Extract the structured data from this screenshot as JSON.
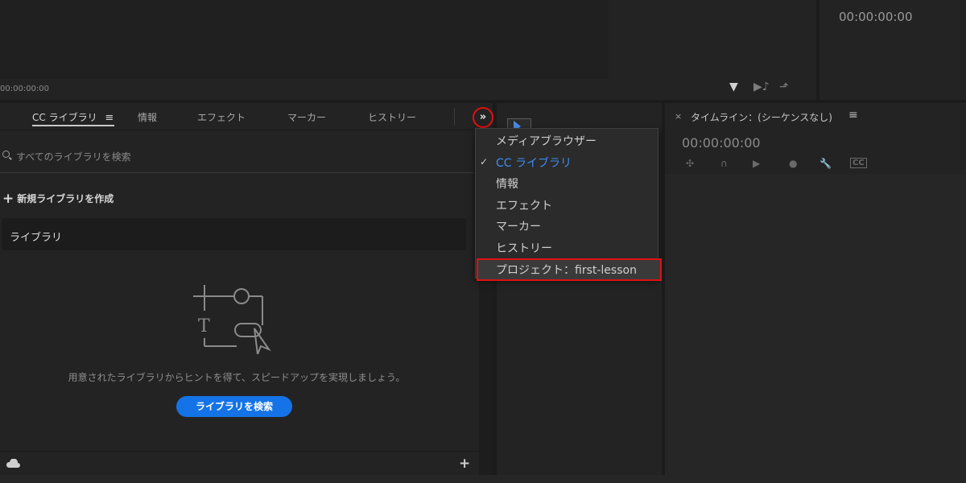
{
  "monitor": {
    "source_timecode": "00:00:00:00",
    "program_timecode": "00:00:00:00"
  },
  "left_panel": {
    "tabs": [
      {
        "label": "CC ライブラリ"
      },
      {
        "label": "情報"
      },
      {
        "label": "エフェクト"
      },
      {
        "label": "マーカー"
      },
      {
        "label": "ヒストリー"
      }
    ],
    "search_placeholder": "すべてのライブラリを検索",
    "new_library_label": "新規ライブラリを作成",
    "library_select_label": "ライブラリ",
    "hint_text": "用意されたライブラリからヒントを得て、スピードアップを実現しましょう。",
    "search_button_label": "ライブラリを検索"
  },
  "dropdown": {
    "items": [
      {
        "label": "メディアブラウザー"
      },
      {
        "label": "CC ライブラリ"
      },
      {
        "label": "情報"
      },
      {
        "label": "エフェクト"
      },
      {
        "label": "マーカー"
      },
      {
        "label": "ヒストリー"
      },
      {
        "label": "プロジェクト：first-lesson"
      }
    ],
    "checked_item": "CC ライブラリ",
    "highlighted_item": "プロジェクト：first-lesson"
  },
  "timeline": {
    "title": "タイムライン：(シーケンスなし)",
    "timecode": "00:00:00:00"
  },
  "colors": {
    "accent": "#1473e6",
    "highlight_outline": "#e01010",
    "checked_text": "#3e8ef0"
  }
}
